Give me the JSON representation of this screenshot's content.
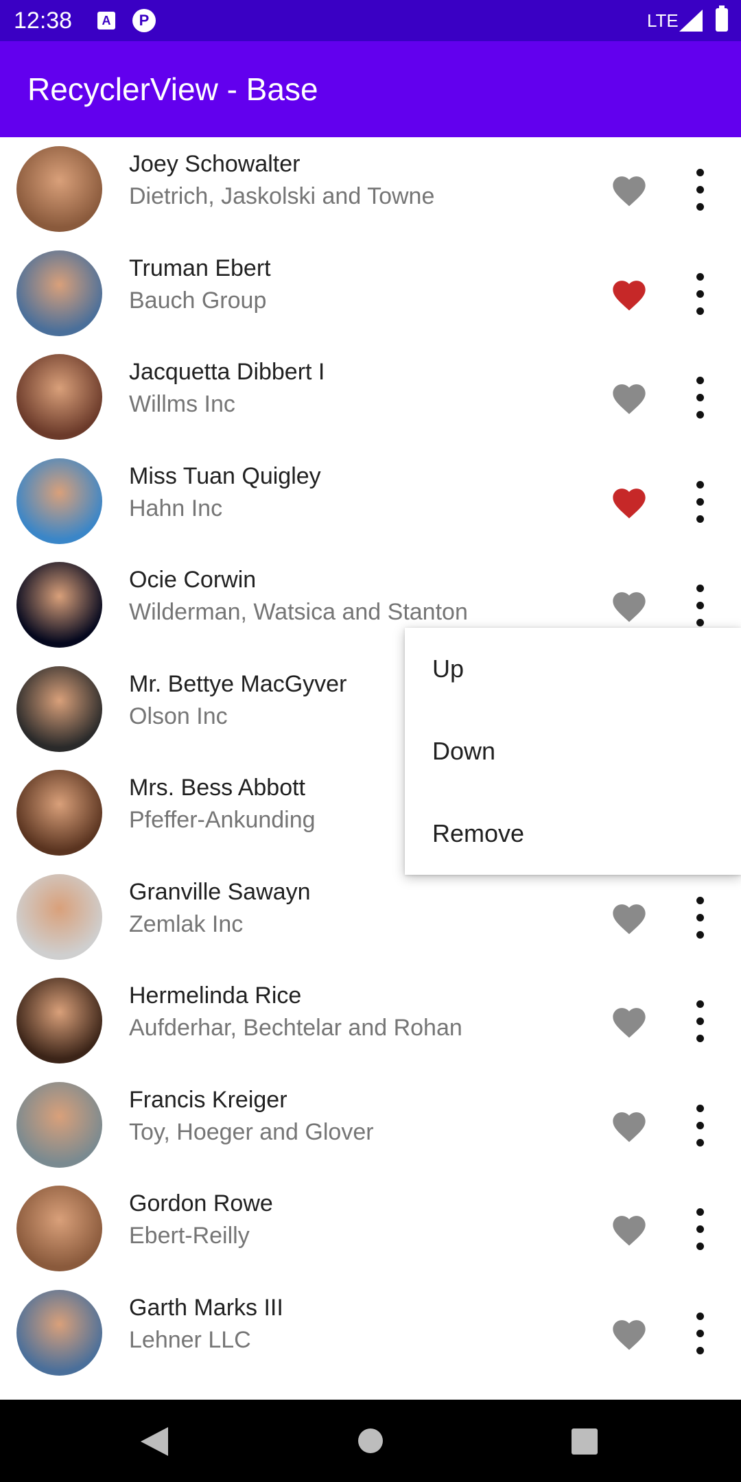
{
  "status_bar": {
    "time": "12:38",
    "notification_icons": [
      "a-badge-icon",
      "p-badge-icon"
    ],
    "network": "LTE",
    "icons": [
      "signal-icon",
      "battery-icon"
    ]
  },
  "app_bar": {
    "title": "RecyclerView - Base",
    "color": "#6200ee"
  },
  "list": {
    "items": [
      {
        "name": "Joey Schowalter",
        "company": "Dietrich, Jaskolski and Towne",
        "favorite": false,
        "avatar_color": "#8a5a3c"
      },
      {
        "name": "Truman Ebert",
        "company": "Bauch Group",
        "favorite": true,
        "avatar_color": "#4a6f9a"
      },
      {
        "name": "Jacquetta Dibbert I",
        "company": "Willms Inc",
        "favorite": false,
        "avatar_color": "#6b3a2a"
      },
      {
        "name": "Miss Tuan Quigley",
        "company": "Hahn Inc",
        "favorite": true,
        "avatar_color": "#3a86c8"
      },
      {
        "name": "Ocie Corwin",
        "company": "Wilderman, Watsica and Stanton",
        "favorite": false,
        "avatar_color": "#05081e"
      },
      {
        "name": "Mr. Bettye MacGyver",
        "company": "Olson Inc",
        "favorite": false,
        "avatar_color": "#2a2a2a"
      },
      {
        "name": "Mrs. Bess Abbott",
        "company": "Pfeffer-Ankunding",
        "favorite": false,
        "avatar_color": "#5a3420"
      },
      {
        "name": "Granville Sawayn",
        "company": "Zemlak Inc",
        "favorite": false,
        "avatar_color": "#cfcfcf"
      },
      {
        "name": "Hermelinda Rice",
        "company": "Aufderhar, Bechtelar and Rohan",
        "favorite": false,
        "avatar_color": "#3b2418"
      },
      {
        "name": "Francis Kreiger",
        "company": "Toy, Hoeger and Glover",
        "favorite": false,
        "avatar_color": "#7a8a90"
      },
      {
        "name": "Gordon Rowe",
        "company": "Ebert-Reilly",
        "favorite": false,
        "avatar_color": "#8a5a3c"
      },
      {
        "name": "Garth Marks III",
        "company": "Lehner LLC",
        "favorite": false,
        "avatar_color": "#4a6f9a"
      }
    ],
    "heart_on_color": "#c62828",
    "heart_off_color": "#8a8a8a"
  },
  "popup_menu": {
    "items": [
      "Up",
      "Down",
      "Remove"
    ]
  },
  "nav_bar": {
    "icons": [
      "back-icon",
      "home-icon",
      "recents-icon"
    ]
  }
}
